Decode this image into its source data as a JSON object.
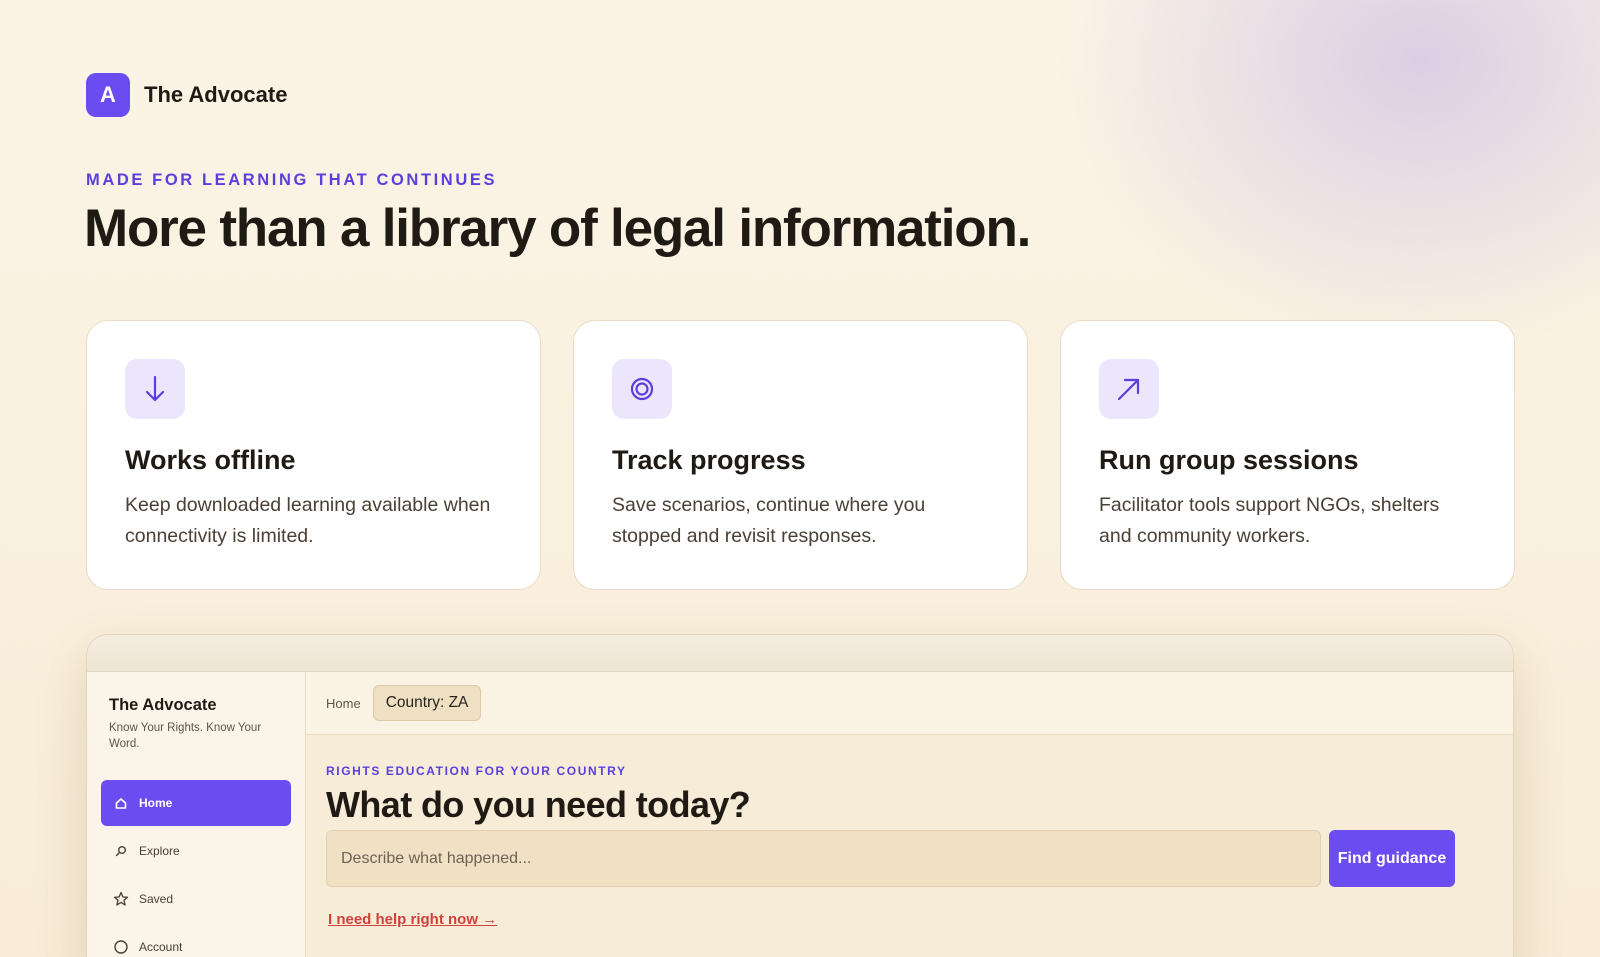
{
  "brand": {
    "logo_letter": "A",
    "name": "The Advocate"
  },
  "hero": {
    "eyebrow": "MADE FOR LEARNING THAT CONTINUES",
    "headline": "More than a library of legal information."
  },
  "features": [
    {
      "icon": "download-arrow-icon",
      "title": "Works offline",
      "description": "Keep downloaded learning available when connectivity is limited."
    },
    {
      "icon": "target-rings-icon",
      "title": "Track progress",
      "description": "Save scenarios, continue where you stopped and revisit responses."
    },
    {
      "icon": "up-right-arrow-icon",
      "title": "Run group sessions",
      "description": "Facilitator tools support NGOs, shelters and community workers."
    }
  ],
  "app_preview": {
    "sidebar": {
      "title": "The Advocate",
      "subtitle": "Know Your Rights. Know Your Word.",
      "items": [
        {
          "label": "Home",
          "icon": "home-icon",
          "active": true
        },
        {
          "label": "Explore",
          "icon": "search-icon",
          "active": false
        },
        {
          "label": "Saved",
          "icon": "star-icon",
          "active": false
        },
        {
          "label": "Account",
          "icon": "circle-icon",
          "active": false
        }
      ]
    },
    "breadcrumb": {
      "home": "Home",
      "country_chip": "Country: ZA"
    },
    "main": {
      "eyebrow": "RIGHTS EDUCATION FOR YOUR COUNTRY",
      "title": "What do you need today?",
      "search_placeholder": "Describe what happened...",
      "find_button": "Find guidance",
      "help_link": "I need help right now →"
    }
  },
  "colors": {
    "accent": "#6a4cf0",
    "urgent_link": "#d2403c",
    "background": "#fbf4e6"
  }
}
